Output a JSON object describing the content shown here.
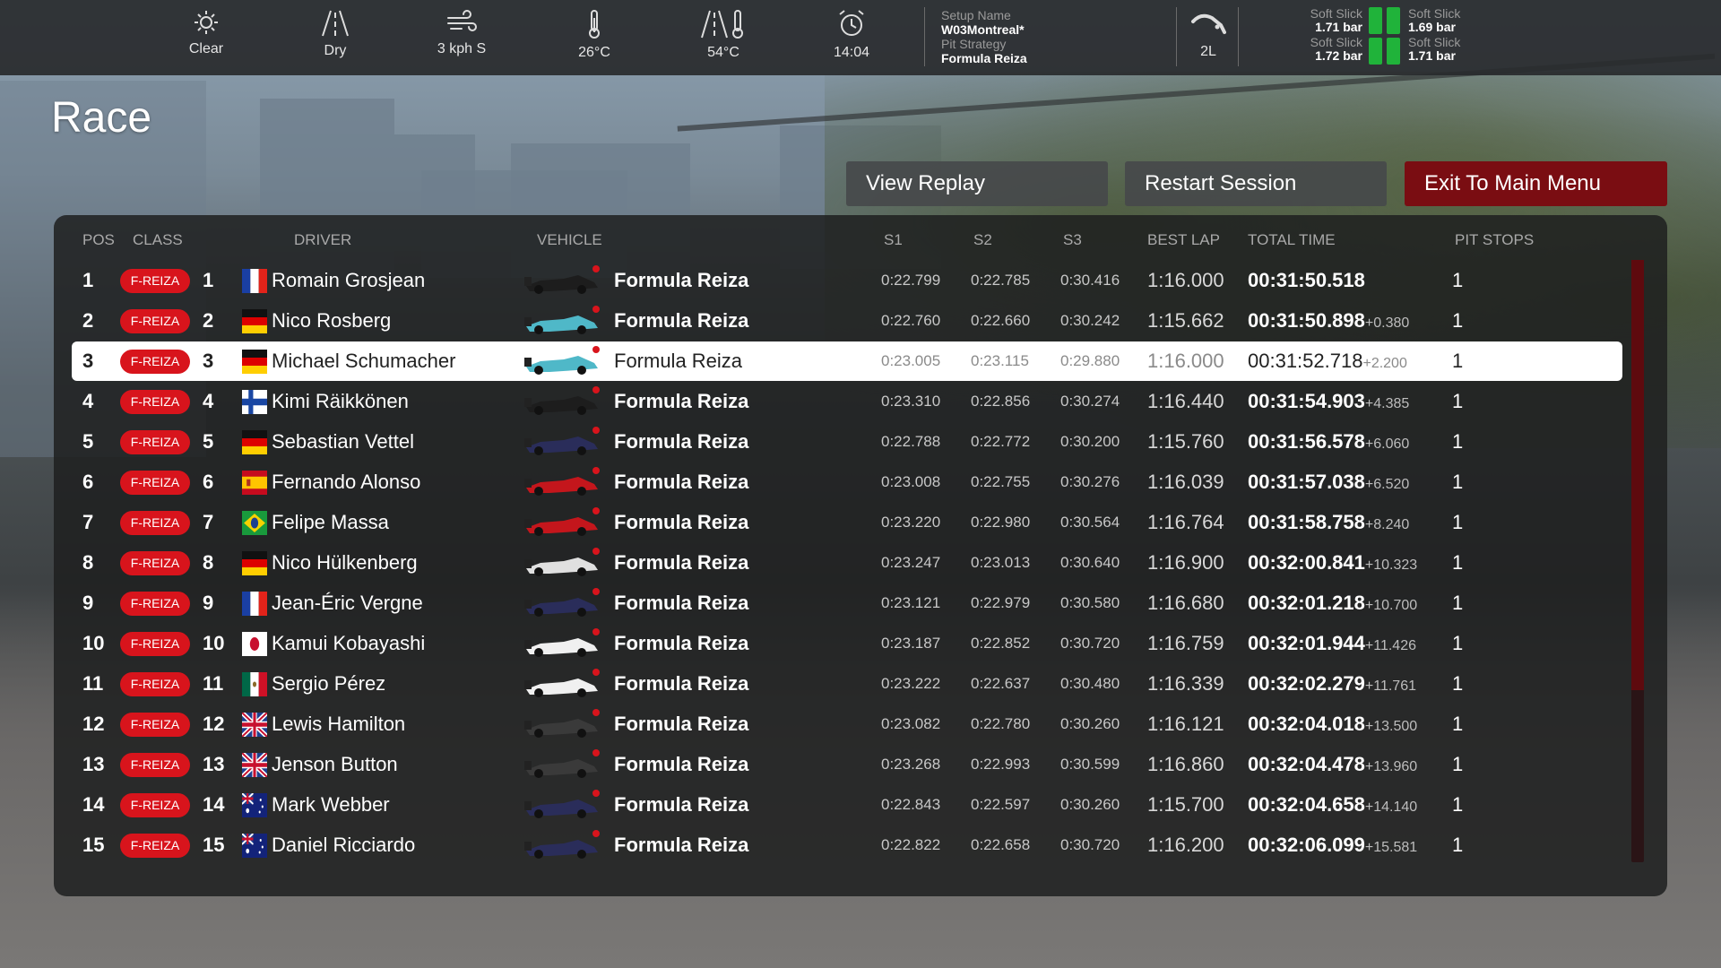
{
  "hud": {
    "weather": "Clear",
    "track_state": "Dry",
    "wind": "3 kph  S",
    "air_temp": "26°C",
    "track_temp": "54°C",
    "time": "14:04",
    "setup_name_label": "Setup Name",
    "setup_name": "W03Montreal*",
    "pit_strategy_label": "Pit Strategy",
    "pit_strategy": "Formula Reiza",
    "fuel": "2L",
    "tyres": [
      {
        "compound": "Soft Slick",
        "pressure": "1.71 bar"
      },
      {
        "compound": "Soft Slick",
        "pressure": "1.69 bar"
      },
      {
        "compound": "Soft Slick",
        "pressure": "1.72 bar"
      },
      {
        "compound": "Soft Slick",
        "pressure": "1.71 bar"
      }
    ],
    "tyre_color": "#20b33a"
  },
  "page_title": "Race",
  "buttons": {
    "view_replay": "View Replay",
    "restart_session": "Restart Session",
    "exit_main_menu": "Exit To Main Menu"
  },
  "columns": {
    "pos": "POS",
    "class": "CLASS",
    "driver": "DRIVER",
    "vehicle": "VEHICLE",
    "s1": "S1",
    "s2": "S2",
    "s3": "S3",
    "best_lap": "BEST LAP",
    "total_time": "TOTAL TIME",
    "pit_stops": "PIT STOPS"
  },
  "accent_color": "#d8141c",
  "selected_row": 3,
  "results": [
    {
      "pos": "1",
      "cls": "F-REIZA",
      "num": "1",
      "flag": "fr",
      "driver": "Romain Grosjean",
      "car": "#1d1d1d",
      "vehicle": "Formula Reiza",
      "s1": "0:22.799",
      "s2": "0:22.785",
      "s3": "0:30.416",
      "best": "1:16.000",
      "total": "00:31:50.518",
      "gap": "",
      "pits": "1"
    },
    {
      "pos": "2",
      "cls": "F-REIZA",
      "num": "2",
      "flag": "de",
      "driver": "Nico Rosberg",
      "car": "#4fb8c8",
      "vehicle": "Formula Reiza",
      "s1": "0:22.760",
      "s2": "0:22.660",
      "s3": "0:30.242",
      "best": "1:15.662",
      "total": "00:31:50.898",
      "gap": "+0.380",
      "pits": "1"
    },
    {
      "pos": "3",
      "cls": "F-REIZA",
      "num": "3",
      "flag": "de",
      "driver": "Michael Schumacher",
      "car": "#4fb8c8",
      "vehicle": "Formula Reiza",
      "s1": "0:23.005",
      "s2": "0:23.115",
      "s3": "0:29.880",
      "best": "1:16.000",
      "total": "00:31:52.718",
      "gap": "+2.200",
      "pits": "1"
    },
    {
      "pos": "4",
      "cls": "F-REIZA",
      "num": "4",
      "flag": "fi",
      "driver": "Kimi Räikkönen",
      "car": "#1d1d1d",
      "vehicle": "Formula Reiza",
      "s1": "0:23.310",
      "s2": "0:22.856",
      "s3": "0:30.274",
      "best": "1:16.440",
      "total": "00:31:54.903",
      "gap": "+4.385",
      "pits": "1"
    },
    {
      "pos": "5",
      "cls": "F-REIZA",
      "num": "5",
      "flag": "de",
      "driver": "Sebastian Vettel",
      "car": "#2a2d5a",
      "vehicle": "Formula Reiza",
      "s1": "0:22.788",
      "s2": "0:22.772",
      "s3": "0:30.200",
      "best": "1:15.760",
      "total": "00:31:56.578",
      "gap": "+6.060",
      "pits": "1"
    },
    {
      "pos": "6",
      "cls": "F-REIZA",
      "num": "6",
      "flag": "es",
      "driver": "Fernando Alonso",
      "car": "#c4161c",
      "vehicle": "Formula Reiza",
      "s1": "0:23.008",
      "s2": "0:22.755",
      "s3": "0:30.276",
      "best": "1:16.039",
      "total": "00:31:57.038",
      "gap": "+6.520",
      "pits": "1"
    },
    {
      "pos": "7",
      "cls": "F-REIZA",
      "num": "7",
      "flag": "br",
      "driver": "Felipe Massa",
      "car": "#c4161c",
      "vehicle": "Formula Reiza",
      "s1": "0:23.220",
      "s2": "0:22.980",
      "s3": "0:30.564",
      "best": "1:16.764",
      "total": "00:31:58.758",
      "gap": "+8.240",
      "pits": "1"
    },
    {
      "pos": "8",
      "cls": "F-REIZA",
      "num": "8",
      "flag": "de",
      "driver": "Nico Hülkenberg",
      "car": "#e0e0e0",
      "vehicle": "Formula Reiza",
      "s1": "0:23.247",
      "s2": "0:23.013",
      "s3": "0:30.640",
      "best": "1:16.900",
      "total": "00:32:00.841",
      "gap": "+10.323",
      "pits": "1"
    },
    {
      "pos": "9",
      "cls": "F-REIZA",
      "num": "9",
      "flag": "fr",
      "driver": "Jean-Éric Vergne",
      "car": "#2a2d5a",
      "vehicle": "Formula Reiza",
      "s1": "0:23.121",
      "s2": "0:22.979",
      "s3": "0:30.580",
      "best": "1:16.680",
      "total": "00:32:01.218",
      "gap": "+10.700",
      "pits": "1"
    },
    {
      "pos": "10",
      "cls": "F-REIZA",
      "num": "10",
      "flag": "jp",
      "driver": "Kamui Kobayashi",
      "car": "#f0f0f0",
      "vehicle": "Formula Reiza",
      "s1": "0:23.187",
      "s2": "0:22.852",
      "s3": "0:30.720",
      "best": "1:16.759",
      "total": "00:32:01.944",
      "gap": "+11.426",
      "pits": "1"
    },
    {
      "pos": "11",
      "cls": "F-REIZA",
      "num": "11",
      "flag": "mx",
      "driver": "Sergio Pérez",
      "car": "#f0f0f0",
      "vehicle": "Formula Reiza",
      "s1": "0:23.222",
      "s2": "0:22.637",
      "s3": "0:30.480",
      "best": "1:16.339",
      "total": "00:32:02.279",
      "gap": "+11.761",
      "pits": "1"
    },
    {
      "pos": "12",
      "cls": "F-REIZA",
      "num": "12",
      "flag": "gb",
      "driver": "Lewis Hamilton",
      "car": "#3a3a3a",
      "vehicle": "Formula Reiza",
      "s1": "0:23.082",
      "s2": "0:22.780",
      "s3": "0:30.260",
      "best": "1:16.121",
      "total": "00:32:04.018",
      "gap": "+13.500",
      "pits": "1"
    },
    {
      "pos": "13",
      "cls": "F-REIZA",
      "num": "13",
      "flag": "gb",
      "driver": "Jenson Button",
      "car": "#3a3a3a",
      "vehicle": "Formula Reiza",
      "s1": "0:23.268",
      "s2": "0:22.993",
      "s3": "0:30.599",
      "best": "1:16.860",
      "total": "00:32:04.478",
      "gap": "+13.960",
      "pits": "1"
    },
    {
      "pos": "14",
      "cls": "F-REIZA",
      "num": "14",
      "flag": "au",
      "driver": "Mark Webber",
      "car": "#2a2d5a",
      "vehicle": "Formula Reiza",
      "s1": "0:22.843",
      "s2": "0:22.597",
      "s3": "0:30.260",
      "best": "1:15.700",
      "total": "00:32:04.658",
      "gap": "+14.140",
      "pits": "1"
    },
    {
      "pos": "15",
      "cls": "F-REIZA",
      "num": "15",
      "flag": "au",
      "driver": "Daniel Ricciardo",
      "car": "#2a2d5a",
      "vehicle": "Formula Reiza",
      "s1": "0:22.822",
      "s2": "0:22.658",
      "s3": "0:30.720",
      "best": "1:16.200",
      "total": "00:32:06.099",
      "gap": "+15.581",
      "pits": "1"
    }
  ]
}
